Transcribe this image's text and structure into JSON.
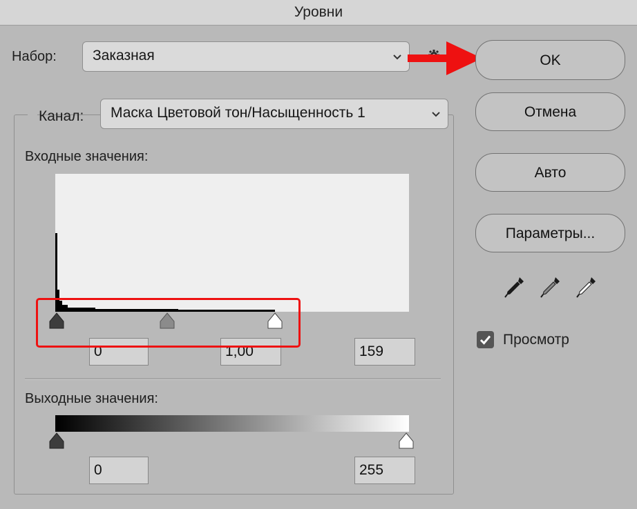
{
  "window": {
    "title": "Уровни"
  },
  "preset": {
    "label": "Набор:",
    "value": "Заказная"
  },
  "channel": {
    "label": "Канал:",
    "value": "Маска Цветовой тон/Насыщенность 1"
  },
  "input_levels": {
    "label": "Входные значения:",
    "black": "0",
    "gamma": "1,00",
    "white": "159"
  },
  "output_levels": {
    "label": "Выходные значения:",
    "black": "0",
    "white": "255"
  },
  "buttons": {
    "ok": "OK",
    "cancel": "Отмена",
    "auto": "Авто",
    "options": "Параметры..."
  },
  "preview": {
    "label": "Просмотр",
    "checked": true
  },
  "colors": {
    "highlight": "#ee1111",
    "arrow": "#ee1111",
    "dialog_bg": "#b9b9b9"
  },
  "icons": [
    "gear-icon",
    "black-eyedropper-icon",
    "gray-eyedropper-icon",
    "white-eyedropper-icon",
    "chevron-down-icon",
    "checkmark-icon"
  ]
}
